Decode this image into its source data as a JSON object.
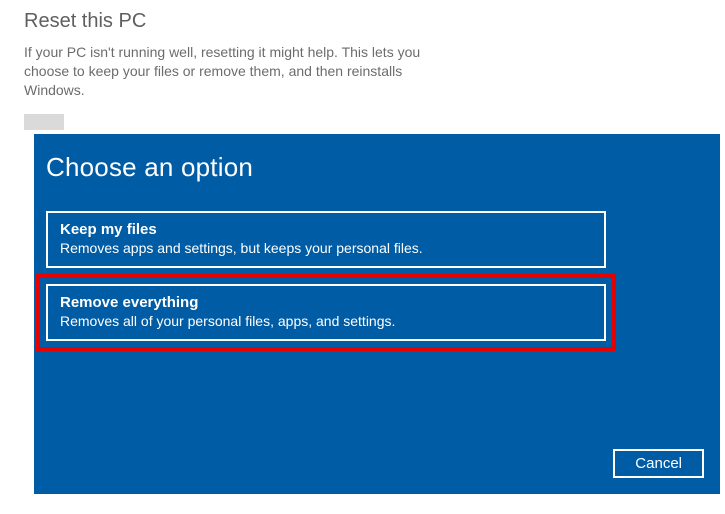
{
  "background": {
    "title": "Reset this PC",
    "description": "If your PC isn't running well, resetting it might help. This lets you choose to keep your files or remove them, and then reinstalls Windows.",
    "button_label": ""
  },
  "modal": {
    "title": "Choose an option",
    "options": [
      {
        "title": "Keep my files",
        "description": "Removes apps and settings, but keeps your personal files."
      },
      {
        "title": "Remove everything",
        "description": "Removes all of your personal files, apps, and settings."
      }
    ],
    "cancel_label": "Cancel"
  }
}
